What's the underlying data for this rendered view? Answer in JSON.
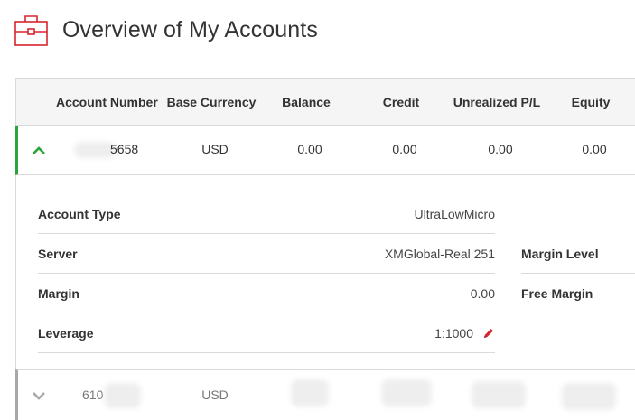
{
  "page": {
    "title": "Overview of My Accounts",
    "icon": "briefcase-icon"
  },
  "table": {
    "headers": {
      "account_number": "Account Number",
      "base_currency": "Base Currency",
      "balance": "Balance",
      "credit": "Credit",
      "unrealized_pl": "Unrealized P/L",
      "equity": "Equity"
    },
    "rows": [
      {
        "expanded": true,
        "account_number_visible": "5658",
        "base_currency": "USD",
        "balance": "0.00",
        "credit": "0.00",
        "unrealized_pl": "0.00",
        "equity": "0.00"
      },
      {
        "expanded": false,
        "account_number_visible": "610",
        "base_currency": "USD"
      }
    ]
  },
  "details": {
    "account_type": {
      "label": "Account Type",
      "value": "UltraLowMicro"
    },
    "server": {
      "label": "Server",
      "value": "XMGlobal-Real 251"
    },
    "margin": {
      "label": "Margin",
      "value": "0.00"
    },
    "leverage": {
      "label": "Leverage",
      "value": "1:1000"
    },
    "margin_level": {
      "label": "Margin Level"
    },
    "free_margin": {
      "label": "Free Margin"
    }
  },
  "colors": {
    "accent_red": "#d9252f",
    "expanded_border": "#2aa43c",
    "collapsed_border": "#a8a8a8"
  }
}
